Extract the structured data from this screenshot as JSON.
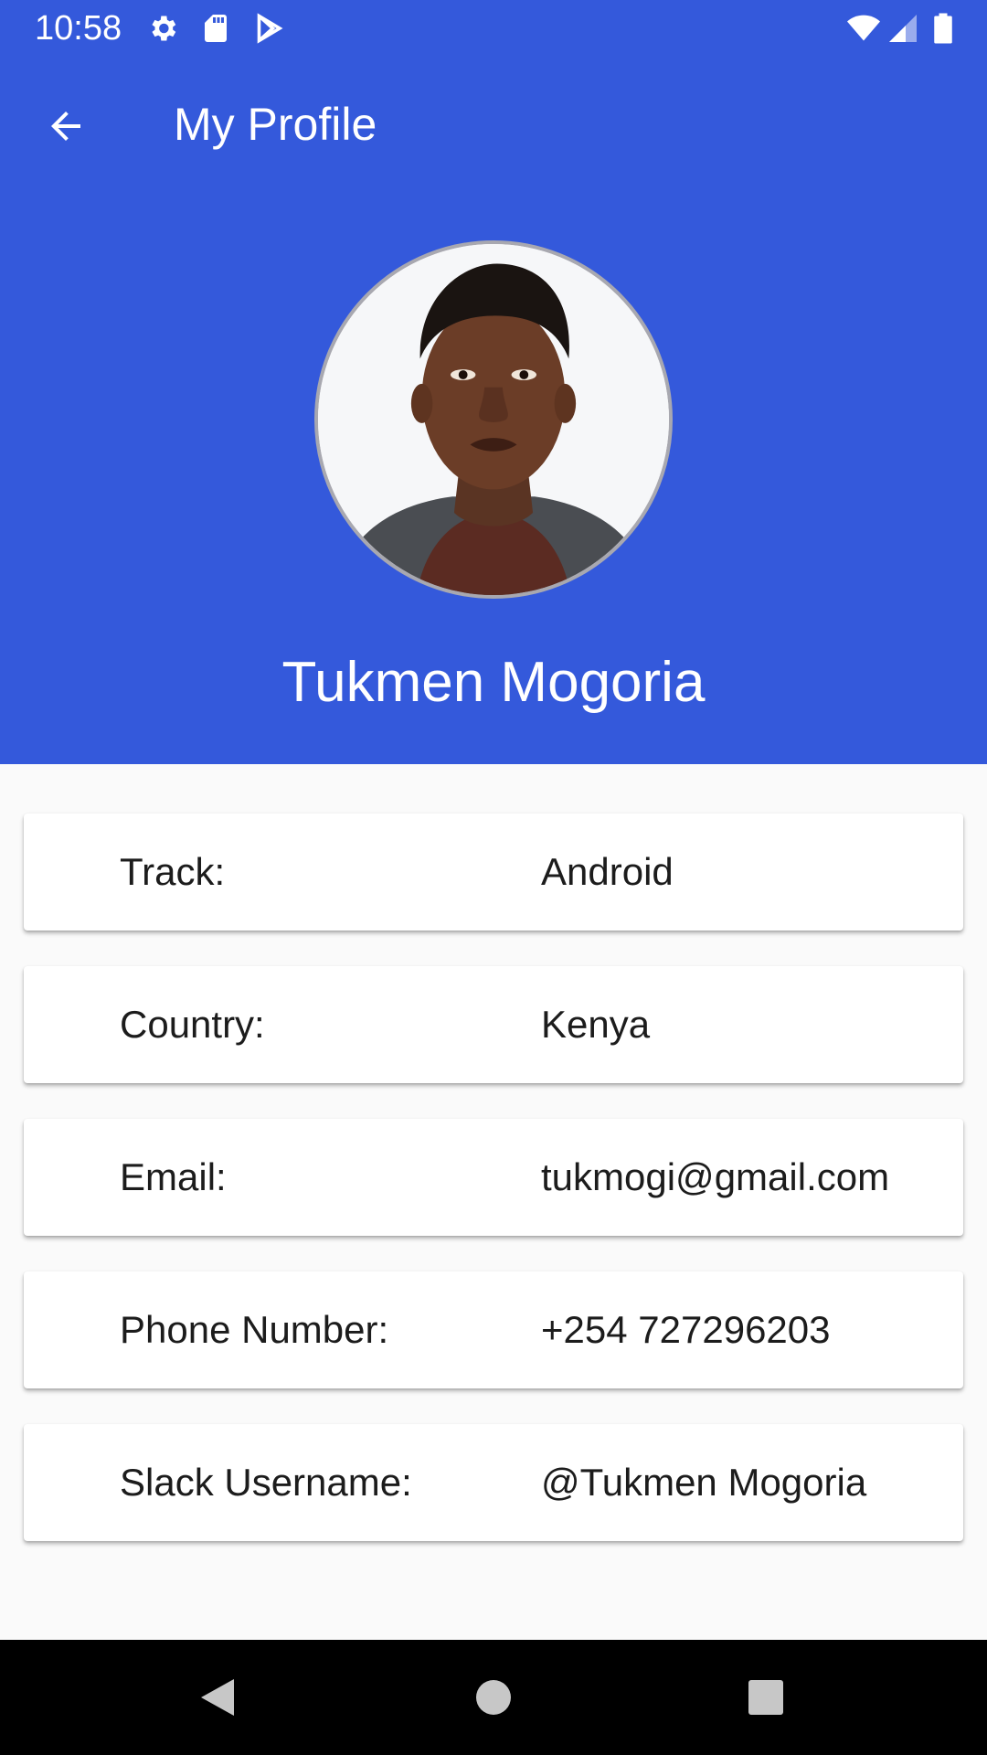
{
  "status_bar": {
    "time": "10:58",
    "icons": [
      "settings-icon",
      "sd-card-icon",
      "play-store-icon",
      "wifi-icon",
      "signal-icon",
      "battery-icon"
    ]
  },
  "toolbar": {
    "back_icon": "arrow-back-icon",
    "title": "My Profile"
  },
  "profile": {
    "name": "Tukmen Mogoria"
  },
  "details": [
    {
      "label": "Track:",
      "value": "Android"
    },
    {
      "label": "Country:",
      "value": "Kenya"
    },
    {
      "label": "Email:",
      "value": "tukmogi@gmail.com"
    },
    {
      "label": "Phone Number:",
      "value": "+254 727296203"
    },
    {
      "label": "Slack Username:",
      "value": "@Tukmen Mogoria"
    }
  ],
  "nav_bar": {
    "buttons": [
      "back-triangle-icon",
      "home-circle-icon",
      "recents-square-icon"
    ]
  },
  "colors": {
    "primary": "#3459DB",
    "background": "#fafafa",
    "card": "#ffffff",
    "text_dark": "#1c1c1c",
    "nav_bar": "#000000"
  }
}
